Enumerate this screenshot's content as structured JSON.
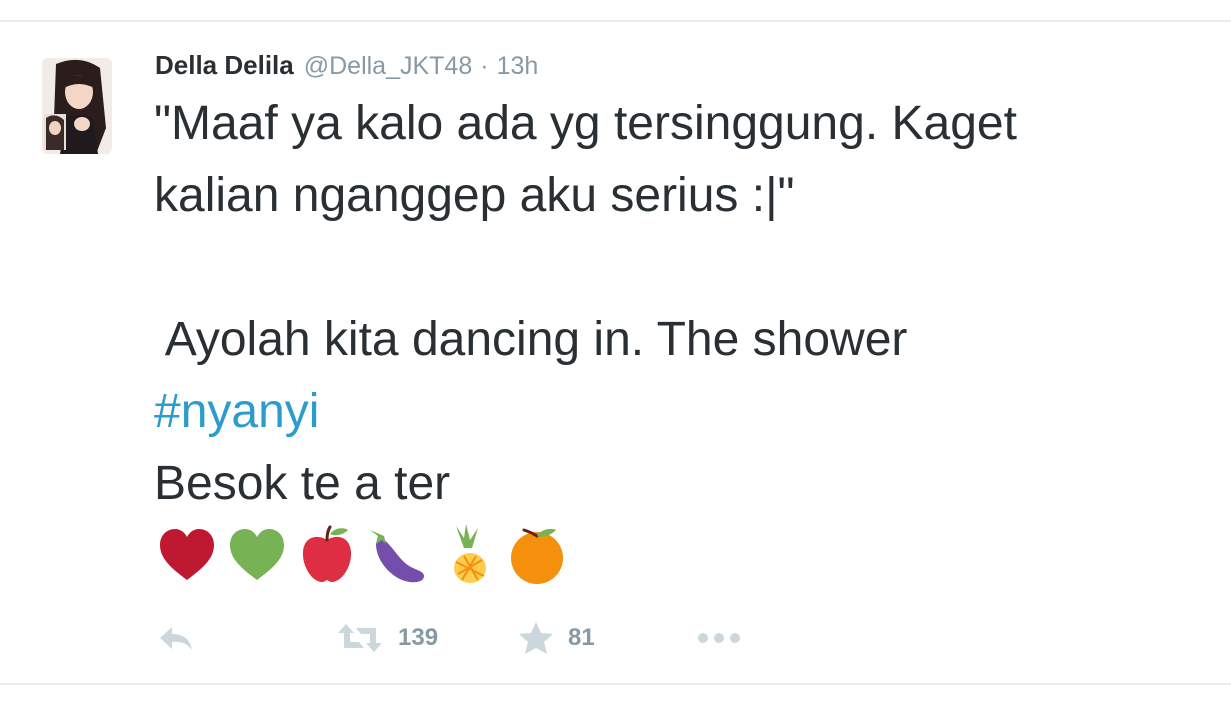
{
  "tweet": {
    "fullname": "Della Delila",
    "username": "@Della_JKT48",
    "separator": "·",
    "timestamp": "13h",
    "lines": [
      "\"Maaf ya kalo ada yg tersinggung. Kaget",
      "kalian nganggep aku serius :|\"",
      " Ayolah kita dancing in. The shower",
      "#nyanyi",
      "Besok te a ter"
    ],
    "emojis": [
      "red-heart-icon",
      "green-heart-icon",
      "red-apple-icon",
      "eggplant-icon",
      "pineapple-icon",
      "tangerine-icon"
    ]
  },
  "actions": {
    "retweet_count": "139",
    "favorite_count": "81"
  },
  "colors": {
    "hashtag": "#2b9ccd",
    "meta_gray": "#8899a6",
    "text": "#292f33",
    "divider": "#e6ecf0"
  }
}
